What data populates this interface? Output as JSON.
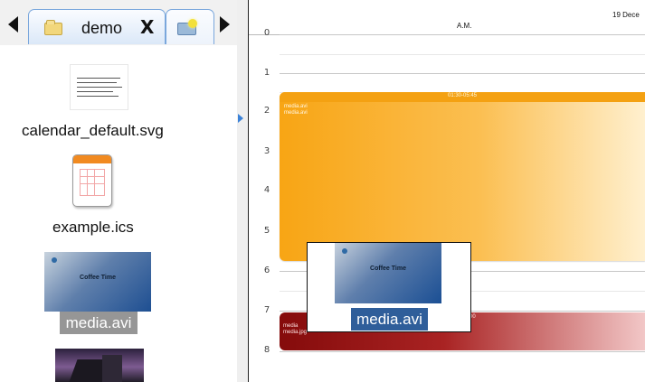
{
  "file_browser": {
    "tabs": [
      {
        "label": "demo",
        "close_symbol": "X",
        "icon": "folder-icon"
      },
      {
        "label": "",
        "icon": "new-folder-icon"
      }
    ],
    "files": [
      {
        "name": "calendar_default.svg",
        "thumbnail": "svg-document-thumbnail"
      },
      {
        "name": "example.ics",
        "thumbnail": "calendar-file-icon"
      },
      {
        "name": "media.avi",
        "thumbnail": "video-thumbnail",
        "thumbnail_title": "Coffee Time",
        "selected": true
      },
      {
        "name": "",
        "thumbnail": "house-image-thumbnail"
      }
    ]
  },
  "calendar": {
    "header_label": "A.M.",
    "date_label": "19 Dece",
    "hours": [
      "0",
      "1",
      "2",
      "3",
      "4",
      "5",
      "6",
      "7",
      "8"
    ],
    "events": [
      {
        "time": "01:30-05:45",
        "files": [
          "media.avi",
          "media.avi"
        ],
        "color": "#f8a514"
      },
      {
        "time": "00",
        "files": [
          "media",
          "media.jpg"
        ],
        "color": "#850b0b"
      }
    ]
  },
  "drag_proxy": {
    "label": "media.avi",
    "thumbnail_title": "Coffee Time"
  },
  "colors": {
    "tab_border": "#7aa7dc",
    "orange_event": "#f8a514",
    "red_event": "#850b0b",
    "selection": "#969696"
  }
}
